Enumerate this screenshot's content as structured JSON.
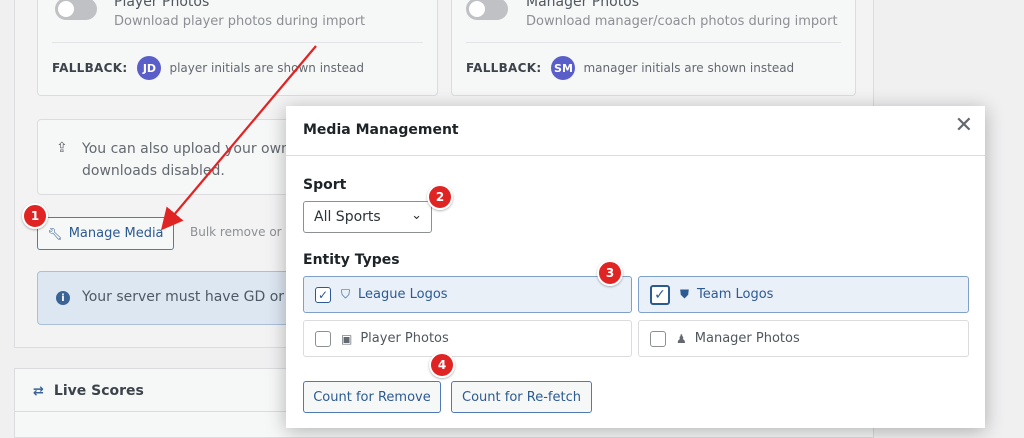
{
  "background": {
    "player_card": {
      "title": "Player Photos",
      "description": "Download player photos during import",
      "fallback_label": "FALLBACK:",
      "initials": "JD",
      "fallback_text": "player initials are shown instead"
    },
    "manager_card": {
      "title": "Manager Photos",
      "description": "Download manager/coach photos during import",
      "fallback_label": "FALLBACK:",
      "initials": "SM",
      "fallback_text": "manager initials are shown instead"
    },
    "upload_note": "You can also upload your own l downloads disabled.",
    "manage_button": "Manage Media",
    "bulk_text": "Bulk remove or r",
    "server_notice": "Your server must have GD or In",
    "live_scores_title": "Live Scores"
  },
  "modal": {
    "title": "Media Management",
    "close_glyph": "✕",
    "sport_label": "Sport",
    "sport_selected": "All Sports",
    "entity_label": "Entity Types",
    "entities": [
      {
        "label": "League Logos",
        "checked": true,
        "icon": "shield-icon"
      },
      {
        "label": "Team Logos",
        "checked": true,
        "icon": "shield-icon"
      },
      {
        "label": "Player Photos",
        "checked": false,
        "icon": "id-card-icon"
      },
      {
        "label": "Manager Photos",
        "checked": false,
        "icon": "person-icon"
      }
    ],
    "buttons": {
      "count_remove": "Count for Remove",
      "count_refetch": "Count for Re-fetch"
    }
  },
  "badges": [
    "1",
    "2",
    "3",
    "4"
  ],
  "colors": {
    "accent": "#2c5a93",
    "badge": "#e02424",
    "initials_bg": "#5a5ec9",
    "notice_bg": "#dde7f2"
  }
}
